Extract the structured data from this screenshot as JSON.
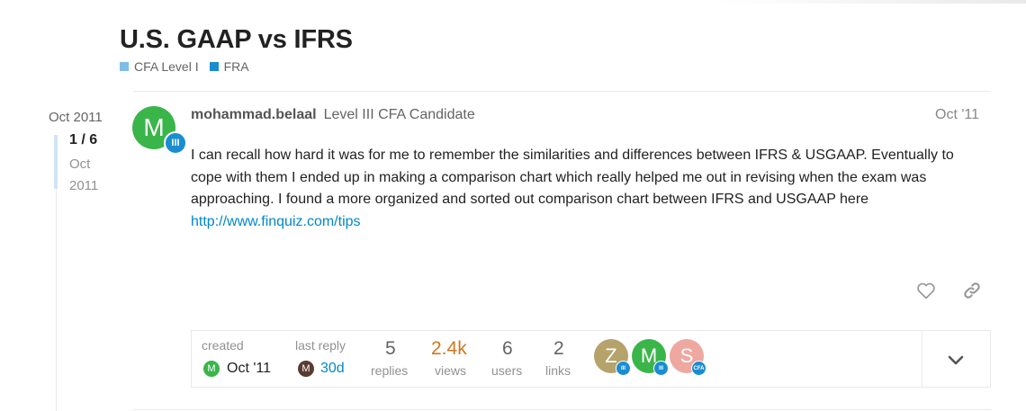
{
  "topic": {
    "title": "U.S. GAAP vs IFRS",
    "categories": [
      {
        "label": "CFA Level I",
        "color": "#7dbde6"
      },
      {
        "label": "FRA",
        "color": "#1a8dd1"
      }
    ]
  },
  "timeline": {
    "date": "Oct 2011",
    "position": "1 / 6",
    "sub_month": "Oct",
    "sub_year": "2011"
  },
  "post": {
    "avatar_letter": "M",
    "avatar_badge": "III",
    "username": "mohammad.belaal",
    "user_title": "Level III CFA Candidate",
    "date": "Oct '11",
    "body_text": "I can recall how hard it was for me to remember the similarities and differences between IFRS & USGAAP. Eventually to cope with them I ended up in making a comparison chart which really helped me out in revising when the exam was approaching. I found a more organized and sorted out comparison chart between IFRS and USGAAP here ",
    "link_text": "http://www.finquiz.com/tips",
    "actions": {
      "like_icon": "heart-icon",
      "link_icon": "link-icon"
    }
  },
  "topic_map": {
    "created_label": "created",
    "created_avatar": "M",
    "created_value": "Oct '11",
    "last_reply_label": "last reply",
    "last_reply_avatar": "M",
    "last_reply_value": "30d",
    "replies_value": "5",
    "replies_label": "replies",
    "views_value": "2.4k",
    "views_label": "views",
    "users_value": "6",
    "users_label": "users",
    "links_value": "2",
    "links_label": "links",
    "participants": [
      {
        "letter": "Z",
        "color": "#b5a36b",
        "badge": "III"
      },
      {
        "letter": "M",
        "color": "#3ab54a",
        "badge": "III"
      },
      {
        "letter": "S",
        "color": "#eea8a0",
        "badge": "CFA"
      }
    ],
    "expand_icon": "chevron-down-icon"
  }
}
